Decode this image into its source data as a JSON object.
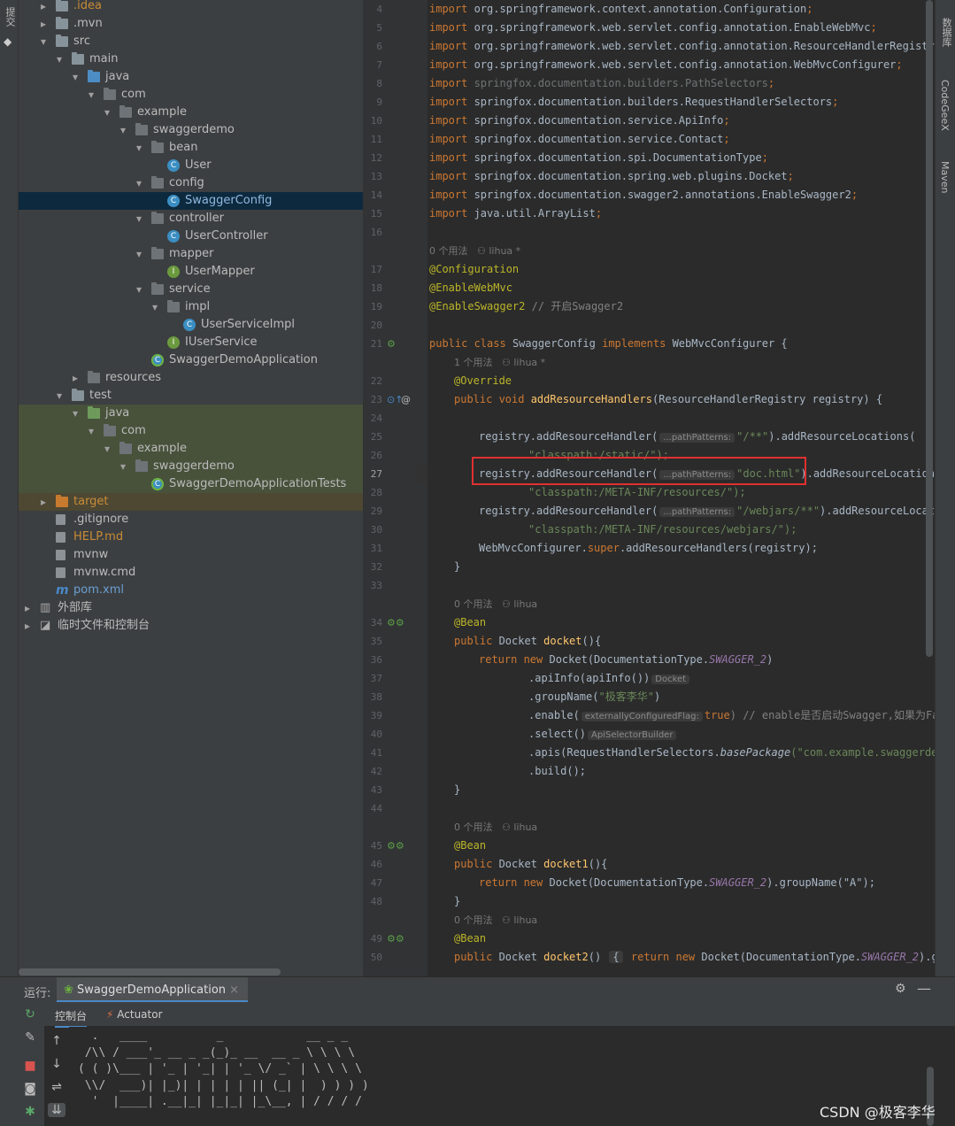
{
  "left_strip": {
    "label": "提交"
  },
  "tree": [
    {
      "label": ".idea",
      "depth": 1,
      "icon": "folder",
      "arrow": ">",
      "color": "orange-text"
    },
    {
      "label": ".mvn",
      "depth": 1,
      "icon": "folder",
      "arrow": ">"
    },
    {
      "label": "src",
      "depth": 1,
      "icon": "folder",
      "arrow": "v"
    },
    {
      "label": "main",
      "depth": 2,
      "icon": "folder",
      "arrow": "v"
    },
    {
      "label": "java",
      "depth": 3,
      "icon": "folder-blue",
      "arrow": "v"
    },
    {
      "label": "com",
      "depth": 4,
      "icon": "package",
      "arrow": "v"
    },
    {
      "label": "example",
      "depth": 5,
      "icon": "package",
      "arrow": "v"
    },
    {
      "label": "swaggerdemo",
      "depth": 6,
      "icon": "package",
      "arrow": "v"
    },
    {
      "label": "bean",
      "depth": 7,
      "icon": "package",
      "arrow": "v"
    },
    {
      "label": "User",
      "depth": 8,
      "icon": "class"
    },
    {
      "label": "config",
      "depth": 7,
      "icon": "package",
      "arrow": "v"
    },
    {
      "label": "SwaggerConfig",
      "depth": 8,
      "icon": "class",
      "selected": true
    },
    {
      "label": "controller",
      "depth": 7,
      "icon": "package",
      "arrow": "v"
    },
    {
      "label": "UserController",
      "depth": 8,
      "icon": "class"
    },
    {
      "label": "mapper",
      "depth": 7,
      "icon": "package",
      "arrow": "v"
    },
    {
      "label": "UserMapper",
      "depth": 8,
      "icon": "interface"
    },
    {
      "label": "service",
      "depth": 7,
      "icon": "package",
      "arrow": "v"
    },
    {
      "label": "impl",
      "depth": 8,
      "icon": "package",
      "arrow": "v"
    },
    {
      "label": "UserServiceImpl",
      "depth": 9,
      "icon": "class"
    },
    {
      "label": "IUserService",
      "depth": 8,
      "icon": "interface"
    },
    {
      "label": "SwaggerDemoApplication",
      "depth": 7,
      "icon": "spring-class"
    },
    {
      "label": "resources",
      "depth": 3,
      "icon": "folder-res",
      "arrow": ">"
    },
    {
      "label": "test",
      "depth": 2,
      "icon": "folder",
      "arrow": "v"
    },
    {
      "label": "java",
      "depth": 3,
      "icon": "folder-green",
      "arrow": "v",
      "test": true
    },
    {
      "label": "com",
      "depth": 4,
      "icon": "package",
      "arrow": "v",
      "test": true
    },
    {
      "label": "example",
      "depth": 5,
      "icon": "package",
      "arrow": "v",
      "test": true
    },
    {
      "label": "swaggerdemo",
      "depth": 6,
      "icon": "package",
      "arrow": "v",
      "test": true
    },
    {
      "label": "SwaggerDemoApplicationTests",
      "depth": 7,
      "icon": "spring-class",
      "test": true
    },
    {
      "label": "target",
      "depth": 1,
      "icon": "folder-orange",
      "arrow": ">",
      "target": true
    },
    {
      "label": ".gitignore",
      "depth": 1,
      "icon": "file"
    },
    {
      "label": "HELP.md",
      "depth": 1,
      "icon": "file-md",
      "color": "orange-text"
    },
    {
      "label": "mvnw",
      "depth": 1,
      "icon": "file"
    },
    {
      "label": "mvnw.cmd",
      "depth": 1,
      "icon": "file"
    },
    {
      "label": "pom.xml",
      "depth": 1,
      "icon": "maven",
      "color": "blue-text"
    },
    {
      "label": "外部库",
      "depth": 0,
      "icon": "library",
      "arrow": ">"
    },
    {
      "label": "临时文件和控制台",
      "depth": 0,
      "icon": "scratch",
      "arrow": ">"
    }
  ],
  "editor": {
    "line_numbers": [
      "4",
      "5",
      "6",
      "7",
      "8",
      "9",
      "10",
      "11",
      "12",
      "13",
      "14",
      "15",
      "16",
      "",
      "17",
      "18",
      "19",
      "20",
      "21",
      "",
      "22",
      "23",
      "24",
      "25",
      "26",
      "27",
      "28",
      "29",
      "30",
      "31",
      "32",
      "33",
      "",
      "34",
      "35",
      "36",
      "37",
      "38",
      "39",
      "40",
      "41",
      "42",
      "43",
      "44",
      "",
      "45",
      "46",
      "47",
      "48",
      "",
      "49",
      "50"
    ],
    "current_line": "27",
    "hint_usage_0": "0 个用法",
    "hint_usage_1": "1 个用法",
    "hint_author": "lihua *",
    "hint_author_plain": "lihua",
    "param_pathPatterns": "...pathPatterns:",
    "param_externallyConfiguredFlag": "externallyConfiguredFlag:",
    "type_Docket": "Docket",
    "type_ApiSelectorBuilder": "ApiSelectorBuilder",
    "lines": {
      "l4": "import org.springframework.context.annotation.Configuration;",
      "l5": "import org.springframework.web.servlet.config.annotation.EnableWebMvc;",
      "l6": "import org.springframework.web.servlet.config.annotation.ResourceHandlerRegistry;",
      "l7": "import org.springframework.web.servlet.config.annotation.WebMvcConfigurer;",
      "l8": "import springfox.documentation.builders.PathSelectors;",
      "l9": "import springfox.documentation.builders.RequestHandlerSelectors;",
      "l10": "import springfox.documentation.service.ApiInfo;",
      "l11": "import springfox.documentation.service.Contact;",
      "l12": "import springfox.documentation.spi.DocumentationType;",
      "l13": "import springfox.documentation.spring.web.plugins.Docket;",
      "l14": "import springfox.documentation.swagger2.annotations.EnableSwagger2;",
      "l15": "import java.util.ArrayList;",
      "l17": "@Configuration",
      "l18": "@EnableWebMvc",
      "l19a": "@EnableSwagger2",
      "l19b": " // 开启Swagger2",
      "l21": "public class SwaggerConfig implements WebMvcConfigurer {",
      "l22": "@Override",
      "l23": "public void addResourceHandlers(ResourceHandlerRegistry registry) {",
      "l25a": "registry.addResourceHandler(",
      "l25b": "\"/**\"",
      "l25c": ").addResourceLocations(",
      "l26": "\"classpath:/static/\");",
      "l27b": "\"doc.html\"",
      "l27c": ").addResourceLocations(",
      "l28": "\"classpath:/META-INF/resources/\");",
      "l29b": "\"/webjars/**\"",
      "l29c": ").addResourceLocatio",
      "l30": "\"classpath:/META-INF/resources/webjars/\");",
      "l31": "WebMvcConfigurer.super.addResourceHandlers(registry);",
      "l32": "}",
      "l34": "@Bean",
      "l35": "public Docket docket(){",
      "l36a": "return new Docket(DocumentationType.",
      "l36b": "SWAGGER_2",
      "l36c": ")",
      "l37": ".apiInfo(apiInfo())",
      "l38a": ".groupName(",
      "l38b": "\"极客李华\"",
      "l38c": ")",
      "l39a": ".enable(",
      "l39b": "true",
      "l39c": ") // enable是否启动Swagger,如果为Fa",
      "l40": ".select()",
      "l41a": ".apis(RequestHandlerSelectors.",
      "l41b": "basePackage",
      "l41c": "(\"com.example.swaggerdemo",
      "l42": ".build();",
      "l43": "}",
      "l46": "public Docket docket1(){",
      "l47a": "return new Docket(DocumentationType.",
      "l47b": "SWAGGER_2",
      "l47c": ").groupName(\"A\");",
      "l48": "}",
      "l50a": "public Docket docket2()",
      "l50b": "{",
      "l50c": " return new Docket(DocumentationType.",
      "l50d": "SWAGGER_2",
      "l50e": ").group"
    }
  },
  "right_strip": [
    "数据库",
    "CodeGeeX",
    "Maven"
  ],
  "run": {
    "label": "运行:",
    "tab": "SwaggerDemoApplication",
    "subtab_console": "控制台",
    "subtab_actuator": "Actuator"
  },
  "console": {
    "lines": [
      "  .   ____          _            __ _ _",
      " /\\\\ / ___'_ __ _ _(_)_ __  __ _ \\ \\ \\ \\",
      "( ( )\\___ | '_ | '_| | '_ \\/ _` | \\ \\ \\ \\",
      " \\\\/  ___)| |_)| | | | | || (_| |  ) ) ) )",
      "  '  |____| .__|_| |_|_| |_\\__, | / / / /"
    ]
  },
  "watermark": "CSDN @极客李华"
}
